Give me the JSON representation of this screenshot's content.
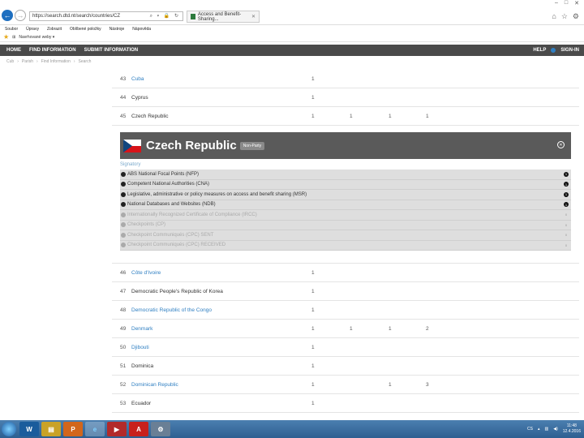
{
  "browser": {
    "url": "https://search.dtd.nt/search/countries/CZ",
    "tab_title": "Access and Benefit-Sharing...",
    "menu": [
      "Soubor",
      "Úpravy",
      "Zobrazit",
      "Oblíbené položky",
      "Nástroje",
      "Nápověda"
    ],
    "favorites_label": "Navrhované weby ▾"
  },
  "site_nav": {
    "items": [
      "HOME",
      "FIND INFORMATION",
      "SUBMIT INFORMATION"
    ],
    "help": "HELP",
    "sign_in": "SIGN-IN"
  },
  "breadcrumb": [
    "Cub",
    "Parish",
    "Find Information",
    "Search"
  ],
  "rows_before": [
    {
      "num": "43",
      "name": "Cuba",
      "link": true,
      "c1": "1",
      "c2": "",
      "c3": "",
      "c4": ""
    },
    {
      "num": "44",
      "name": "Cyprus",
      "link": false,
      "c1": "1",
      "c2": "",
      "c3": "",
      "c4": ""
    },
    {
      "num": "45",
      "name": "Czech Republic",
      "link": false,
      "c1": "1",
      "c2": "1",
      "c3": "1",
      "c4": "1"
    }
  ],
  "detail": {
    "title": "Czech Republic",
    "badge": "Non-Party",
    "signatory": "Signatory",
    "categories": [
      {
        "label": "ABS National Focal Points (NFP)",
        "active": true,
        "count": "1"
      },
      {
        "label": "Competent National Authorities (CNA)",
        "active": true,
        "count": "1"
      },
      {
        "label": "Legislative, administrative or policy measures on access and benefit sharing (MSR)",
        "active": true,
        "count": "1"
      },
      {
        "label": "National Databases and Websites (NDB)",
        "active": true,
        "count": "1"
      },
      {
        "label": "Internationally Recognized Certificate of Compliance (IRCC)",
        "active": false,
        "count": "0"
      },
      {
        "label": "Checkpoints (CP)",
        "active": false,
        "count": "0"
      },
      {
        "label": "Checkpoint Communiqués (CPC) SENT",
        "active": false,
        "count": "0"
      },
      {
        "label": "Checkpoint Communiqués (CPC) RECEIVED",
        "active": false,
        "count": "0"
      }
    ]
  },
  "rows_after": [
    {
      "num": "46",
      "name": "Côte d'Ivoire",
      "link": true,
      "c1": "1",
      "c2": "",
      "c3": "",
      "c4": ""
    },
    {
      "num": "47",
      "name": "Democratic People's Republic of Korea",
      "link": false,
      "c1": "1",
      "c2": "",
      "c3": "",
      "c4": ""
    },
    {
      "num": "48",
      "name": "Democratic Republic of the Congo",
      "link": true,
      "c1": "1",
      "c2": "",
      "c3": "",
      "c4": ""
    },
    {
      "num": "49",
      "name": "Denmark",
      "link": true,
      "c1": "1",
      "c2": "1",
      "c3": "1",
      "c4": "2"
    },
    {
      "num": "50",
      "name": "Djibouti",
      "link": true,
      "c1": "1",
      "c2": "",
      "c3": "",
      "c4": ""
    },
    {
      "num": "51",
      "name": "Dominica",
      "link": false,
      "c1": "1",
      "c2": "",
      "c3": "",
      "c4": ""
    },
    {
      "num": "52",
      "name": "Dominican Republic",
      "link": true,
      "c1": "1",
      "c2": "",
      "c3": "1",
      "c4": "3"
    },
    {
      "num": "53",
      "name": "Ecuador",
      "link": false,
      "c1": "1",
      "c2": "",
      "c3": "",
      "c4": ""
    }
  ],
  "taskbar": {
    "apps": [
      "W",
      "▤",
      "P",
      "e",
      "▶",
      "A",
      "⚙"
    ],
    "lang": "CS",
    "time": "11:48",
    "date": "12.4.2016"
  }
}
